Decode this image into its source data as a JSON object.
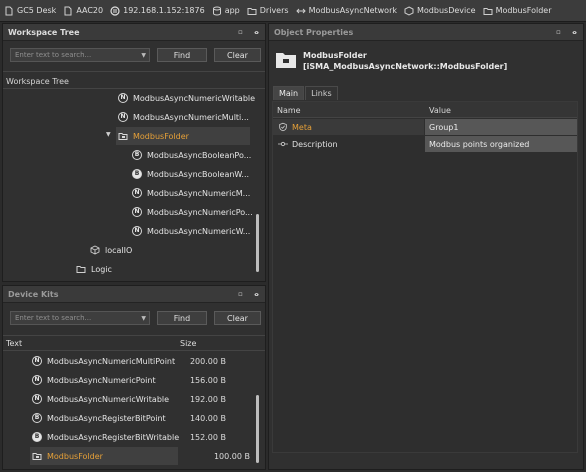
{
  "breadcrumb": [
    {
      "label": "GC5 Desk",
      "icon": "document-icon"
    },
    {
      "label": "AAC20",
      "icon": "document-icon"
    },
    {
      "label": "192.168.1.152:1876",
      "icon": "plug-icon"
    },
    {
      "label": "app",
      "icon": "database-icon"
    },
    {
      "label": "Drivers",
      "icon": "folder-icon"
    },
    {
      "label": "ModbusAsyncNetwork",
      "icon": "network-icon"
    },
    {
      "label": "ModbusDevice",
      "icon": "device-icon"
    },
    {
      "label": "ModbusFolder",
      "icon": "folder-icon"
    }
  ],
  "workspace": {
    "title": "Workspace Tree",
    "search_placeholder": "Enter text to search...",
    "find_label": "Find",
    "clear_label": "Clear",
    "tree_label": "Workspace Tree",
    "items": [
      {
        "label": "ModbusAsyncNumericWritable",
        "badge": "N",
        "filled": false
      },
      {
        "label": "ModbusAsyncNumericMulti...",
        "badge": "N",
        "filled": false
      },
      {
        "label": "ModbusFolder",
        "badge": "folder"
      },
      {
        "label": "ModbusAsyncBooleanPo...",
        "badge": "B",
        "filled": false
      },
      {
        "label": "ModbusAsyncBooleanW...",
        "badge": "B",
        "filled": true
      },
      {
        "label": "ModbusAsyncNumericM...",
        "badge": "N",
        "filled": false
      },
      {
        "label": "ModbusAsyncNumericPo...",
        "badge": "N",
        "filled": false
      },
      {
        "label": "ModbusAsyncNumericW...",
        "badge": "N",
        "filled": false
      },
      {
        "label": "localIO",
        "badge": "cube"
      },
      {
        "label": "Logic",
        "badge": "folder"
      }
    ]
  },
  "kits": {
    "title": "Device Kits",
    "search_placeholder": "Enter text to search...",
    "find_label": "Find",
    "clear_label": "Clear",
    "col_text": "Text",
    "col_size": "Size",
    "items": [
      {
        "label": "ModbusAsyncNumericMultiPoint",
        "size": "200.00 B",
        "badge": "N",
        "filled": false
      },
      {
        "label": "ModbusAsyncNumericPoint",
        "size": "156.00 B",
        "badge": "N",
        "filled": false
      },
      {
        "label": "ModbusAsyncNumericWritable",
        "size": "192.00 B",
        "badge": "N",
        "filled": false
      },
      {
        "label": "ModbusAsyncRegisterBitPoint",
        "size": "140.00 B",
        "badge": "B",
        "filled": false
      },
      {
        "label": "ModbusAsyncRegisterBitWritable",
        "size": "152.00 B",
        "badge": "B",
        "filled": true
      },
      {
        "label": "ModbusFolder",
        "size": "100.00 B",
        "badge": "folder"
      }
    ]
  },
  "object": {
    "title": "Object Properties",
    "name": "ModbusFolder",
    "type": "[iSMA_ModbusAsyncNetwork::ModbusFolder]",
    "tabs": [
      "Main",
      "Links"
    ],
    "col_name": "Name",
    "col_value": "Value",
    "rows": [
      {
        "name": "Meta",
        "value": "Group1"
      },
      {
        "name": "Description",
        "value": "Modbus points organized"
      }
    ]
  },
  "colors": {
    "accent": "#e6a038",
    "background": "#2b2b2b",
    "panel": "#303030"
  }
}
